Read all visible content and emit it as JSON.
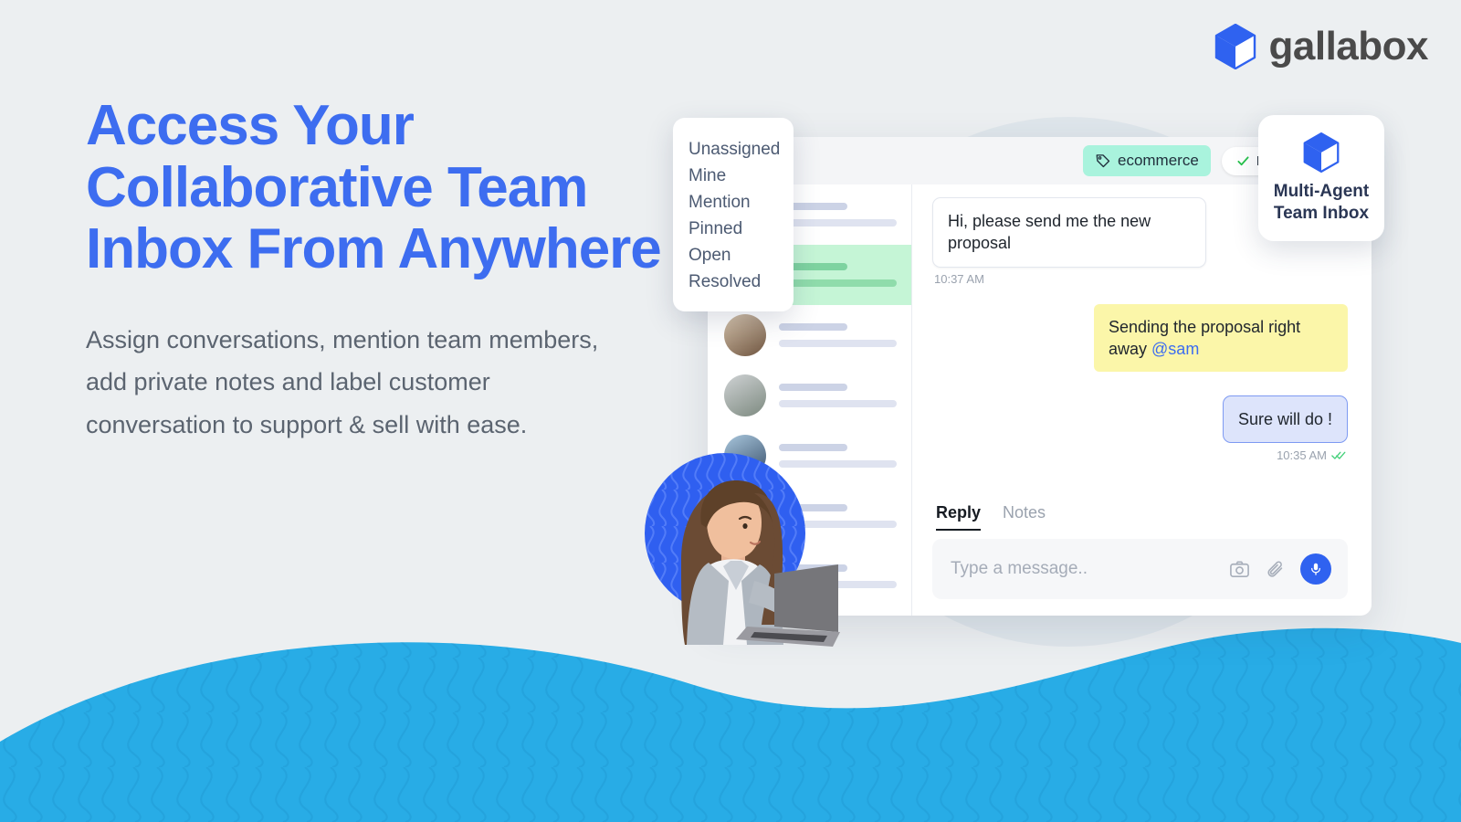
{
  "brand": {
    "logo_text": "gallabox",
    "logo_icon": "cube-icon",
    "accent_blue": "#3d6df0",
    "wave_blue": "#28ace6",
    "background": "#eceff1"
  },
  "hero": {
    "headline": "Access Your Collaborative Team Inbox From Anywhere",
    "subcopy": "Assign conversations, mention team members, add private notes and label customer conversation to support & sell with ease."
  },
  "badge": {
    "icon": "cube-icon",
    "line1": "Multi-Agent",
    "line2": "Team Inbox"
  },
  "filter_menu": {
    "items": [
      {
        "label": "Unassigned"
      },
      {
        "label": "Mine"
      },
      {
        "label": "Mention"
      },
      {
        "label": "Pinned"
      },
      {
        "label": "Open"
      },
      {
        "label": "Resolved"
      }
    ]
  },
  "app": {
    "topbar": {
      "tag_label": "ecommerce",
      "tag_icon": "tag-icon",
      "tag_color": "#a9f3dd",
      "resolve_label": "Resolve",
      "resolve_icon": "check-icon",
      "resolve_check_color": "#27c24c",
      "avatar_icon": "user-avatar"
    },
    "conversation_list": {
      "rows": [
        {
          "avatar": "avatar-1",
          "selected": false
        },
        {
          "avatar": "avatar-2",
          "selected": true
        },
        {
          "avatar": "avatar-3",
          "selected": false
        },
        {
          "avatar": "avatar-4",
          "selected": false
        },
        {
          "avatar": "avatar-5",
          "selected": false
        },
        {
          "avatar": "avatar-6",
          "selected": false
        },
        {
          "avatar": "avatar-7",
          "selected": false
        }
      ]
    },
    "chat": {
      "messages": [
        {
          "kind": "incoming",
          "text": "Hi, please send me the new proposal",
          "time": "10:37 AM"
        },
        {
          "kind": "note",
          "text": "Sending the proposal right away ",
          "mention": "@sam",
          "time": ""
        },
        {
          "kind": "reply",
          "text": "Sure will do !",
          "time": "10:35 AM",
          "status_icon": "double-check-icon"
        }
      ]
    },
    "composer": {
      "tabs": [
        {
          "label": "Reply",
          "active": true
        },
        {
          "label": "Notes",
          "active": false
        }
      ],
      "placeholder": "Type a message..",
      "actions": [
        {
          "icon": "camera-icon"
        },
        {
          "icon": "paperclip-icon"
        },
        {
          "icon": "microphone-icon"
        }
      ]
    }
  }
}
